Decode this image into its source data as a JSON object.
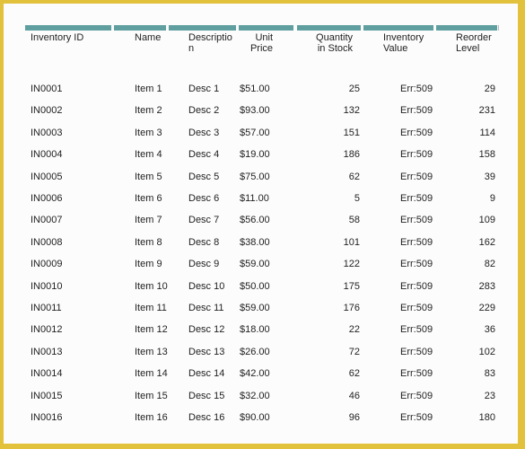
{
  "table": {
    "headers": [
      {
        "label": "Inventory ID"
      },
      {
        "label": "Name"
      },
      {
        "label": "Descriptio\nn"
      },
      {
        "label": "Unit\nPrice"
      },
      {
        "label": "Quantity\nin Stock"
      },
      {
        "label": "Inventory\nValue"
      },
      {
        "label": "Reorder\nLevel"
      }
    ],
    "header_bar_color": "#5f9fa0",
    "rows": [
      {
        "id": "IN0001",
        "name": "Item 1",
        "desc": "Desc 1",
        "price": "$51.00",
        "qty": "25",
        "value": "Err:509",
        "reorder": "29"
      },
      {
        "id": "IN0002",
        "name": "Item 2",
        "desc": "Desc 2",
        "price": "$93.00",
        "qty": "132",
        "value": "Err:509",
        "reorder": "231"
      },
      {
        "id": "IN0003",
        "name": "Item 3",
        "desc": "Desc 3",
        "price": "$57.00",
        "qty": "151",
        "value": "Err:509",
        "reorder": "114"
      },
      {
        "id": "IN0004",
        "name": "Item 4",
        "desc": "Desc 4",
        "price": "$19.00",
        "qty": "186",
        "value": "Err:509",
        "reorder": "158"
      },
      {
        "id": "IN0005",
        "name": "Item 5",
        "desc": "Desc 5",
        "price": "$75.00",
        "qty": "62",
        "value": "Err:509",
        "reorder": "39"
      },
      {
        "id": "IN0006",
        "name": "Item 6",
        "desc": "Desc 6",
        "price": "$11.00",
        "qty": "5",
        "value": "Err:509",
        "reorder": "9"
      },
      {
        "id": "IN0007",
        "name": "Item 7",
        "desc": "Desc 7",
        "price": "$56.00",
        "qty": "58",
        "value": "Err:509",
        "reorder": "109"
      },
      {
        "id": "IN0008",
        "name": "Item 8",
        "desc": "Desc 8",
        "price": "$38.00",
        "qty": "101",
        "value": "Err:509",
        "reorder": "162"
      },
      {
        "id": "IN0009",
        "name": "Item 9",
        "desc": "Desc 9",
        "price": "$59.00",
        "qty": "122",
        "value": "Err:509",
        "reorder": "82"
      },
      {
        "id": "IN0010",
        "name": "Item 10",
        "desc": "Desc 10",
        "price": "$50.00",
        "qty": "175",
        "value": "Err:509",
        "reorder": "283"
      },
      {
        "id": "IN0011",
        "name": "Item 11",
        "desc": "Desc 11",
        "price": "$59.00",
        "qty": "176",
        "value": "Err:509",
        "reorder": "229"
      },
      {
        "id": "IN0012",
        "name": "Item 12",
        "desc": "Desc 12",
        "price": "$18.00",
        "qty": "22",
        "value": "Err:509",
        "reorder": "36"
      },
      {
        "id": "IN0013",
        "name": "Item 13",
        "desc": "Desc 13",
        "price": "$26.00",
        "qty": "72",
        "value": "Err:509",
        "reorder": "102"
      },
      {
        "id": "IN0014",
        "name": "Item 14",
        "desc": "Desc 14",
        "price": "$42.00",
        "qty": "62",
        "value": "Err:509",
        "reorder": "83"
      },
      {
        "id": "IN0015",
        "name": "Item 15",
        "desc": "Desc 15",
        "price": "$32.00",
        "qty": "46",
        "value": "Err:509",
        "reorder": "23"
      },
      {
        "id": "IN0016",
        "name": "Item 16",
        "desc": "Desc 16",
        "price": "$90.00",
        "qty": "96",
        "value": "Err:509",
        "reorder": "180"
      }
    ]
  },
  "frame_color": "#e2c23c"
}
